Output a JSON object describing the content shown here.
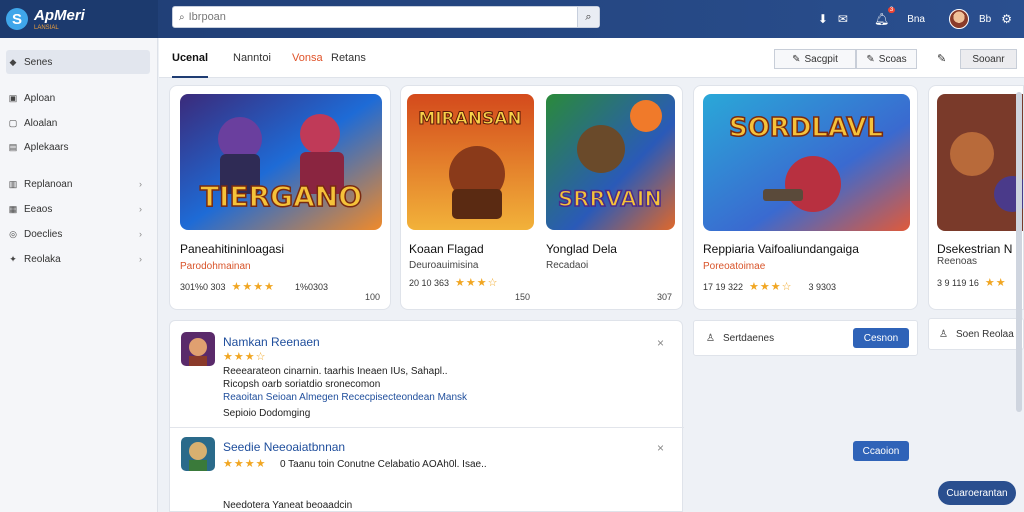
{
  "brand": {
    "name": "ApMeri",
    "sub": "LANSIAL"
  },
  "search": {
    "placeholder": "Ibrpoan"
  },
  "header": {
    "user_name": "Bna",
    "extra_label": "Bb",
    "notification_count": "3"
  },
  "sidebar": {
    "items": [
      {
        "label": "Senes",
        "icon": "search-icon",
        "active": true
      },
      {
        "label": "Aploan",
        "icon": "app-icon"
      },
      {
        "label": "Aloalan",
        "icon": "store-icon"
      },
      {
        "label": "Aplekaars",
        "icon": "grid-icon"
      },
      {
        "label": "Replanoan",
        "icon": "chart-icon",
        "chevron": true
      },
      {
        "label": "Eeaos",
        "icon": "gift-icon",
        "chevron": true
      },
      {
        "label": "Doeclies",
        "icon": "settings-icon",
        "chevron": true
      },
      {
        "label": "Reolaka",
        "icon": "pin-icon",
        "chevron": true
      }
    ]
  },
  "tabs": [
    {
      "label": "Ucenal"
    },
    {
      "label": "Nanntoi"
    },
    {
      "label": "Vonsa"
    },
    {
      "label": "Retans"
    }
  ],
  "toolbar": {
    "btn1": "Sacgpit",
    "btn2": "Scoas",
    "btn3": "Sooanr"
  },
  "cards": [
    {
      "title": "Paneahitininloagasi",
      "sub": "Parodohmainan",
      "rating": "301%0 303",
      "stars": "★★★★",
      "meta": "1%0303",
      "count": "100",
      "art": "TIERGANO"
    },
    {
      "title": "Koaan Flagad",
      "sub": "Deuroauimisina",
      "rating": "20 10 363",
      "stars": "★★★☆",
      "meta": "",
      "count": "150",
      "art": "MIRANSAN"
    },
    {
      "title": "Yonglad Dela",
      "sub": "Recadaoi",
      "rating": "",
      "stars": "",
      "meta": "",
      "count": "307",
      "art": "SRRVAIN"
    },
    {
      "title": "Reppiaria Vaifoaliundangaiga",
      "sub": "Poreoatoimae",
      "rating": "17 19 322",
      "stars": "★★★☆",
      "meta": "3 9303",
      "count": "",
      "art": "SORDLAVL"
    },
    {
      "title": "Dsekestrian N",
      "sub": "Reenoas",
      "rating": "3 9 119 16",
      "stars": "★★",
      "meta": "",
      "count": "",
      "art": ""
    }
  ],
  "list": [
    {
      "title": "Namkan Reenaen",
      "stars": "★★★☆",
      "line1": "Reeearateon cinarnin. taarhis Ineaen IUs, Sahapl..",
      "line2": "Ricopsh oarb soriatdio sronecomon",
      "link": "Reaoitan Seioan Almegen Rececpisecteondean Mansk",
      "line3": "Sepioio Dodomging"
    },
    {
      "title": "Seedie Neeoaiatbnnan",
      "stars": "★★★★",
      "line1": "0 Taanu toin Conutne Celabatio AOAh0l. Isae..",
      "line2": "",
      "link": "",
      "line3": "Needotera Yaneat beoaadcin"
    }
  ],
  "right": {
    "box1": "Sertdaenes",
    "btn1": "Cesnon",
    "box2": "Soen Reolaa",
    "btn2": "Ccaoion",
    "bottom_btn": "Cuaroerantan"
  },
  "colors": {
    "primary": "#1f3d73",
    "accent": "#e0542b",
    "star": "#f1a622",
    "button": "#2f63b8"
  }
}
